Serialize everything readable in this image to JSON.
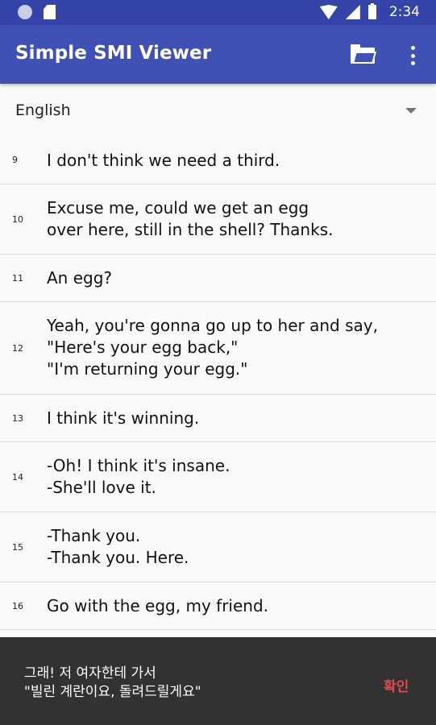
{
  "status_bar": {
    "time": "2:34"
  },
  "app_bar": {
    "title": "Simple SMI Viewer"
  },
  "language_select": {
    "selected": "English"
  },
  "subtitles": [
    {
      "index": "9",
      "text": "I don't think we need a third."
    },
    {
      "index": "10",
      "text": "Excuse me, could we get an egg\nover here, still in the shell? Thanks."
    },
    {
      "index": "11",
      "text": "An egg?"
    },
    {
      "index": "12",
      "text": "Yeah, you're gonna go up to her and say,\n\"Here's your egg back,\"\n\"I'm returning your egg.\""
    },
    {
      "index": "13",
      "text": "I think it's winning."
    },
    {
      "index": "14",
      "text": "-Oh! I think it's insane.\n-She'll love it."
    },
    {
      "index": "15",
      "text": "-Thank you.\n-Thank you. Here."
    },
    {
      "index": "16",
      "text": "Go with the egg, my friend."
    }
  ],
  "snackbar": {
    "message": "그래! 저 여자한테 가서\n\"빌린 계란이요, 돌려드릴게요\"",
    "action": "확인"
  }
}
